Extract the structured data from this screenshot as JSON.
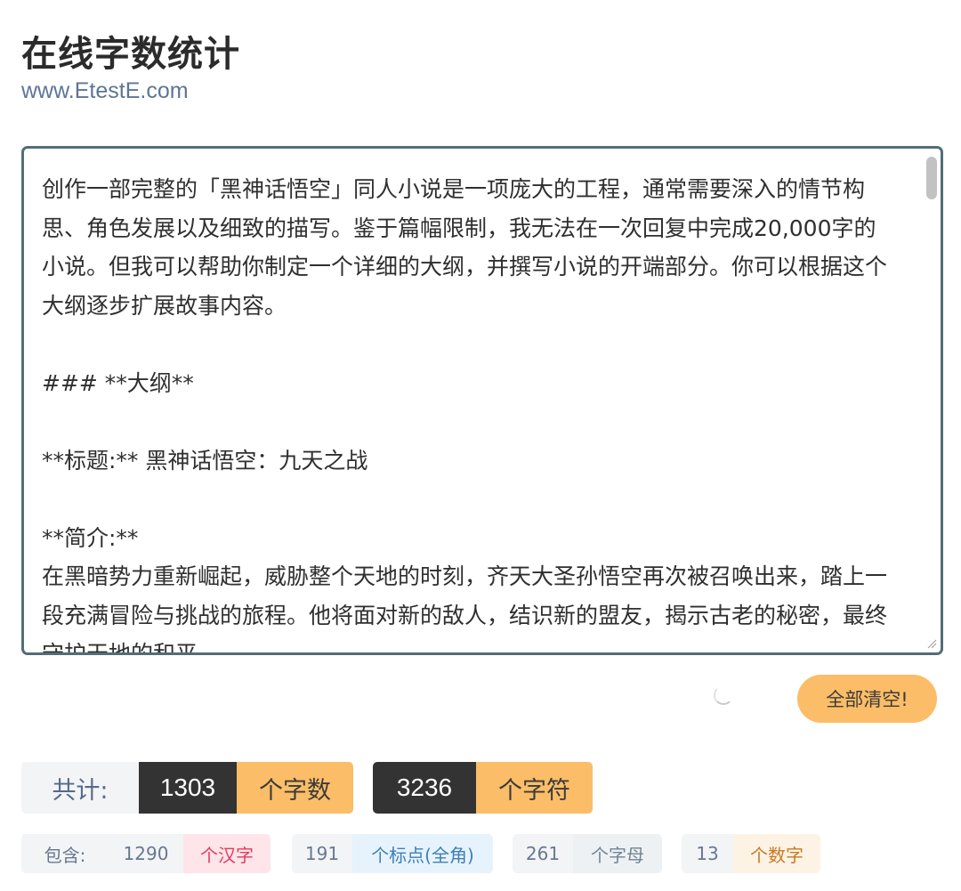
{
  "header": {
    "title": "在线字数统计",
    "subtitle": "www.EtestE.com"
  },
  "editor": {
    "text": "创作一部完整的「黑神话悟空」同人小说是一项庞大的工程，通常需要深入的情节构思、角色发展以及细致的描写。鉴于篇幅限制，我无法在一次回复中完成20,000字的小说。但我可以帮助你制定一个详细的大纲，并撰写小说的开端部分。你可以根据这个大纲逐步扩展故事内容。\n\n### **大纲**\n\n**标题:** 黑神话悟空：九天之战\n\n**简介:**\n在黑暗势力重新崛起，威胁整个天地的时刻，齐天大圣孙悟空再次被召唤出来，踏上一段充满冒险与挑战的旅程。他将面对新的敌人，结识新的盟友，揭示古老的秘密，最终守护天地的和平。"
  },
  "actions": {
    "clear_label": "全部清空!"
  },
  "totals": {
    "label": "共计:",
    "word_count": "1303",
    "word_unit": "个字数",
    "char_count": "3236",
    "char_unit": "个字符"
  },
  "details": {
    "label": "包含:",
    "chinese_count": "1290",
    "chinese_unit": "个汉字",
    "punct_count": "191",
    "punct_unit": "个标点(全角)",
    "letter_count": "261",
    "letter_unit": "个字母",
    "digit_count": "13",
    "digit_unit": "个数字"
  },
  "colors": {
    "accent": "#fbbd67",
    "dark": "#333333",
    "editor_border": "#526e77"
  }
}
